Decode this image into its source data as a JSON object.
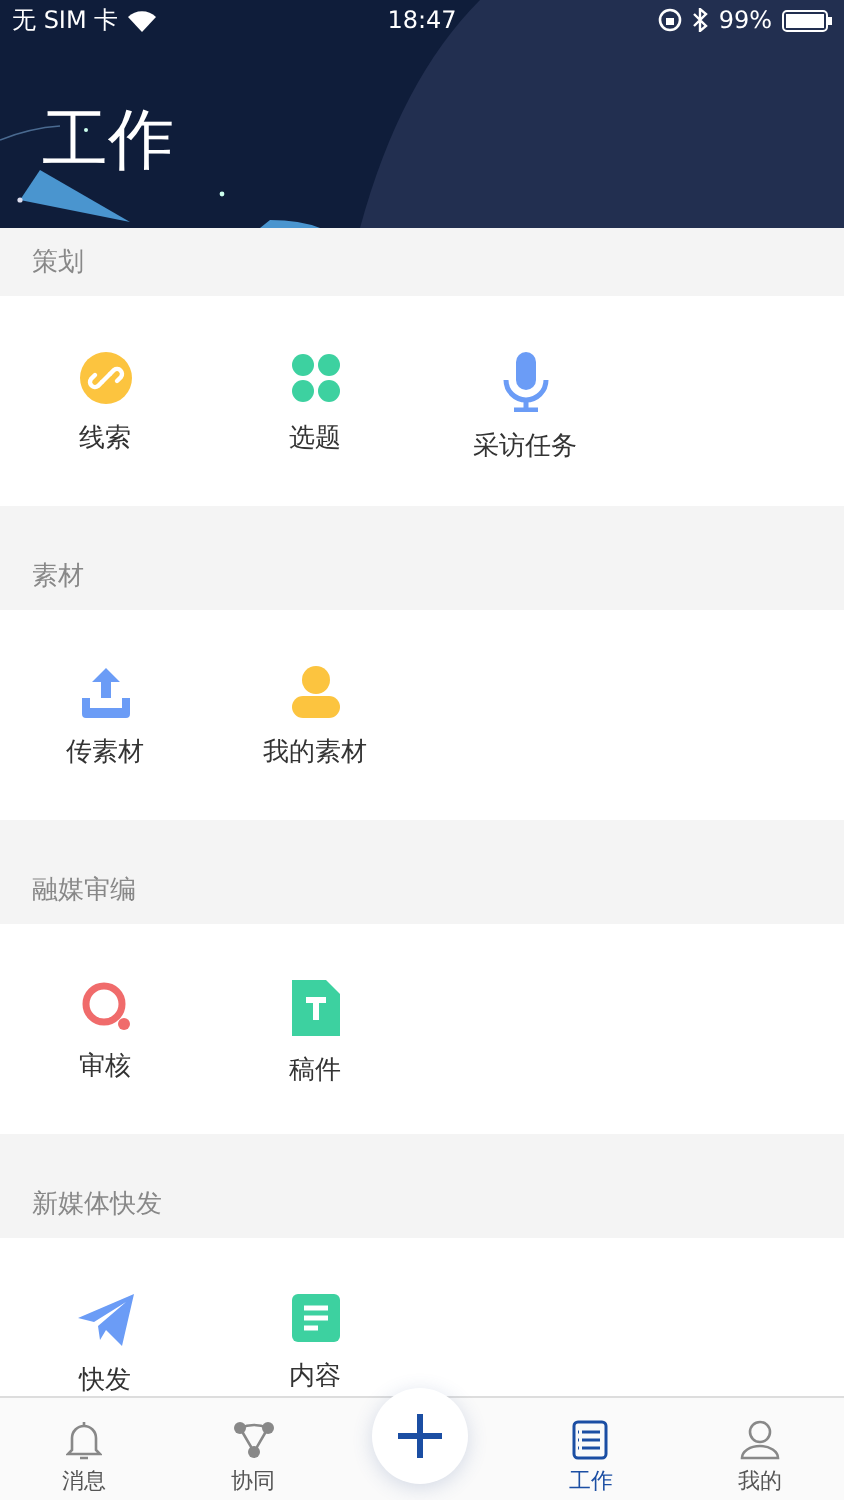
{
  "status_bar": {
    "carrier": "无 SIM 卡",
    "time": "18:47",
    "battery": "99%"
  },
  "header": {
    "title": "工作"
  },
  "sections": [
    {
      "title": "策划",
      "items": [
        {
          "label": "线索"
        },
        {
          "label": "选题"
        },
        {
          "label": "采访任务"
        }
      ]
    },
    {
      "title": "素材",
      "items": [
        {
          "label": "传素材"
        },
        {
          "label": "我的素材"
        }
      ]
    },
    {
      "title": "融媒审编",
      "items": [
        {
          "label": "审核"
        },
        {
          "label": "稿件"
        }
      ]
    },
    {
      "title": "新媒体快发",
      "items": [
        {
          "label": "快发"
        },
        {
          "label": "内容"
        }
      ]
    }
  ],
  "tab_bar": {
    "tabs": [
      {
        "label": "消息",
        "selected": false
      },
      {
        "label": "协同",
        "selected": false
      },
      {
        "label": "工作",
        "selected": true
      },
      {
        "label": "我的",
        "selected": false
      }
    ]
  }
}
